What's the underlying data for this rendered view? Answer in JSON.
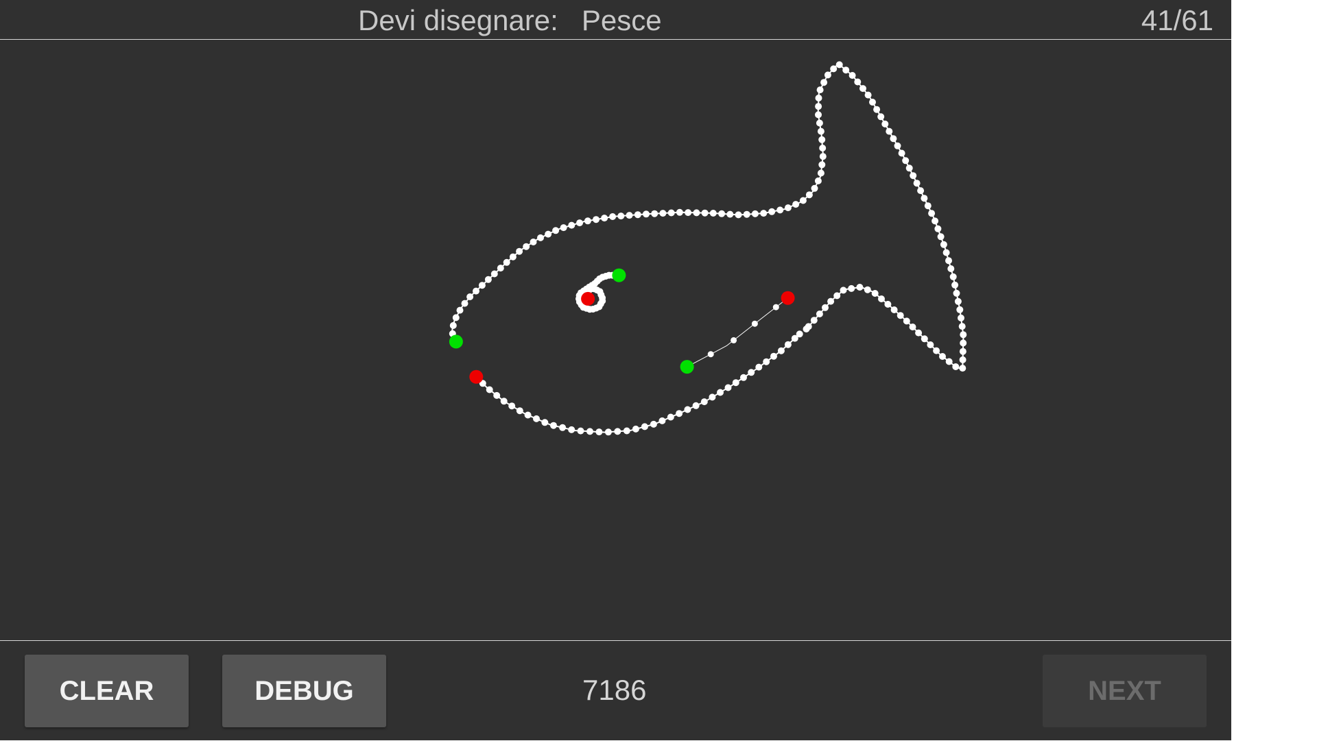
{
  "header": {
    "prompt_label": "Devi disegnare:",
    "prompt_word": "Pesce",
    "progress": "41/61"
  },
  "footer": {
    "clear_label": "CLEAR",
    "debug_label": "DEBUG",
    "score": "7186",
    "next_label": "NEXT"
  },
  "colors": {
    "background": "#303030",
    "stroke": "#ffffff",
    "start_marker": "#00e000",
    "end_marker": "#ee0000",
    "button": "#545454",
    "button_disabled": "#3b3b3b"
  }
}
